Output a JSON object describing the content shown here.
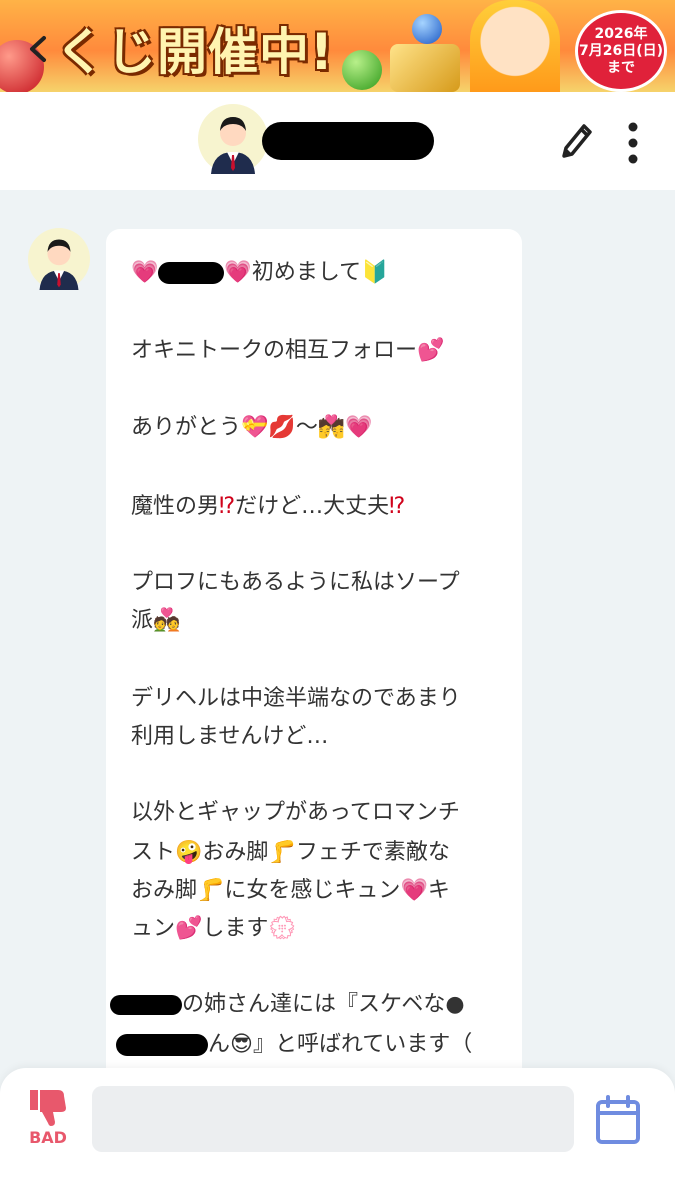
{
  "banner": {
    "title": "くじ開催中!",
    "badge_year": "2026年",
    "badge_date": "7月26日(日)",
    "badge_suffix": "まで"
  },
  "header": {
    "back_icon": "chevron-left-icon",
    "edit_icon": "pencil-icon",
    "more_icon": "more-vertical-icon"
  },
  "message": {
    "lines": [
      "初めまして",
      "オキニトークの相互フォロー",
      "ありがとう",
      "魔性の男",
      "だけど…大丈夫",
      "プロフにもあるように私はソープ",
      "派",
      "デリヘルは中途半端なのであまり",
      "利用しませんけど…",
      "以外とギャップがあってロマンチ",
      "スト",
      "おみ脚",
      "フェチで素敵な",
      "おみ脚",
      "に女を感じキュン",
      "キ",
      "ュン",
      "します",
      "の姉さん達には『スケベな●",
      "ん",
      "』と呼ばれています（"
    ]
  },
  "footer": {
    "bad_label": "BAD",
    "input_value": "",
    "calendar_icon": "calendar-icon",
    "thumbs_icon": "thumbs-down-icon"
  },
  "colors": {
    "accent_pink": "#e8586c",
    "calendar_blue": "#6f8ce0",
    "background": "#eef3f5"
  }
}
